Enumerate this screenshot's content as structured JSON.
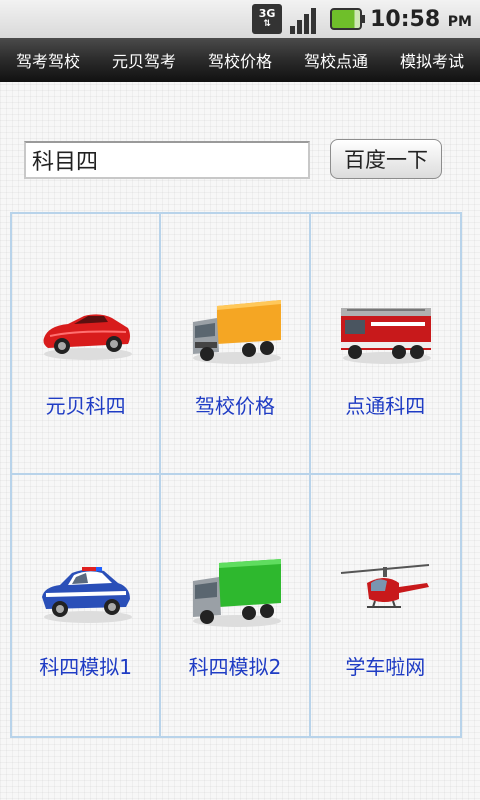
{
  "status_bar": {
    "network": "3G",
    "time": "10:58",
    "ampm": "PM"
  },
  "tabs": [
    "驾考驾校",
    "元贝驾考",
    "驾校价格",
    "驾校点通",
    "模拟考试"
  ],
  "search": {
    "value": "科目四",
    "button_label": "百度一下"
  },
  "grid_items": [
    {
      "label": "元贝科四",
      "icon": "red-convertible-car-icon"
    },
    {
      "label": "驾校价格",
      "icon": "yellow-truck-icon"
    },
    {
      "label": "点通科四",
      "icon": "fire-truck-icon"
    },
    {
      "label": "科四模拟1",
      "icon": "police-car-icon"
    },
    {
      "label": "科四模拟2",
      "icon": "green-truck-icon"
    },
    {
      "label": "学车啦网",
      "icon": "helicopter-icon"
    }
  ],
  "colors": {
    "grid_border": "#b8d3ea",
    "label_blue": "#1f3cc4",
    "tab_bar": "#2b2b2b"
  }
}
